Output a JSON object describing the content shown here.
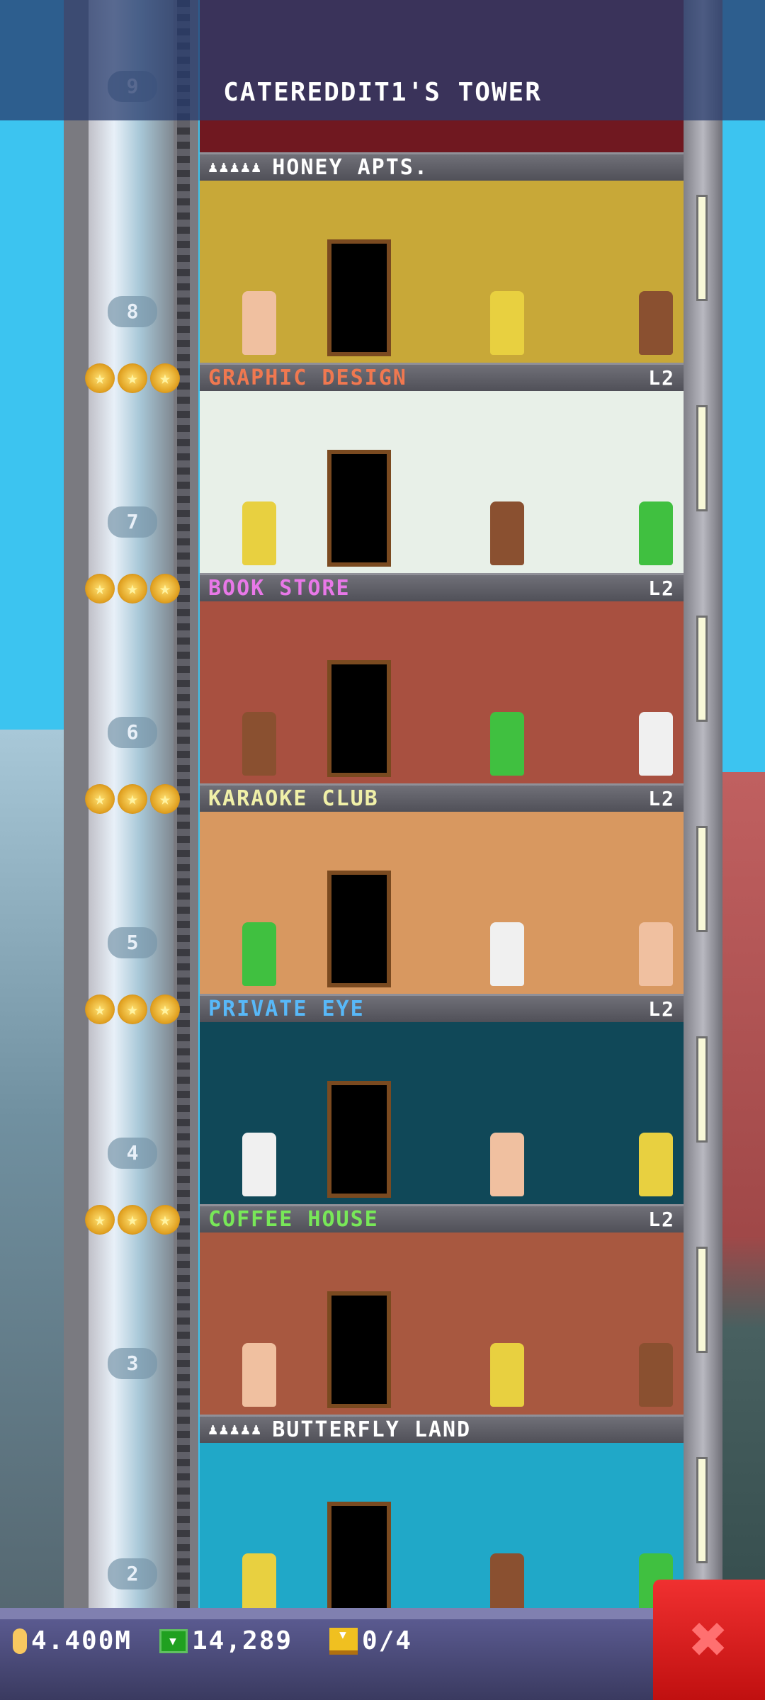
{
  "header": {
    "title": "CATEREDDIT1'S TOWER"
  },
  "top_floor_number": "9",
  "floors": [
    {
      "number": "8",
      "name": "HONEY APTS.",
      "type": "residential",
      "level": "",
      "stars": 0,
      "color": "#ffffff",
      "bg": "#c8a838"
    },
    {
      "number": "7",
      "name": "GRAPHIC DESIGN",
      "type": "business",
      "level": "L2",
      "stars": 3,
      "color": "#f07850",
      "bg": "#e8f0e8"
    },
    {
      "number": "6",
      "name": "BOOK STORE",
      "type": "business",
      "level": "L2",
      "stars": 3,
      "color": "#e878e8",
      "bg": "#a85040"
    },
    {
      "number": "5",
      "name": "KARAOKE CLUB",
      "type": "business",
      "level": "L2",
      "stars": 3,
      "color": "#f0f0a8",
      "bg": "#d89860"
    },
    {
      "number": "4",
      "name": "PRIVATE EYE",
      "type": "business",
      "level": "L2",
      "stars": 3,
      "color": "#58b8f8",
      "bg": "#104858"
    },
    {
      "number": "3",
      "name": "COFFEE HOUSE",
      "type": "business",
      "level": "L2",
      "stars": 3,
      "color": "#78e858",
      "bg": "#a85840"
    },
    {
      "number": "2",
      "name": "BUTTERFLY LAND",
      "type": "residential",
      "level": "",
      "stars": 0,
      "color": "#ffffff",
      "bg": "#20a8c8"
    }
  ],
  "resident_icon": "person-icon",
  "star_icon": "star-icon",
  "status": {
    "coins": "4.400M",
    "bux": "14,289",
    "tickets": "0/4"
  },
  "close_icon": "close-icon"
}
